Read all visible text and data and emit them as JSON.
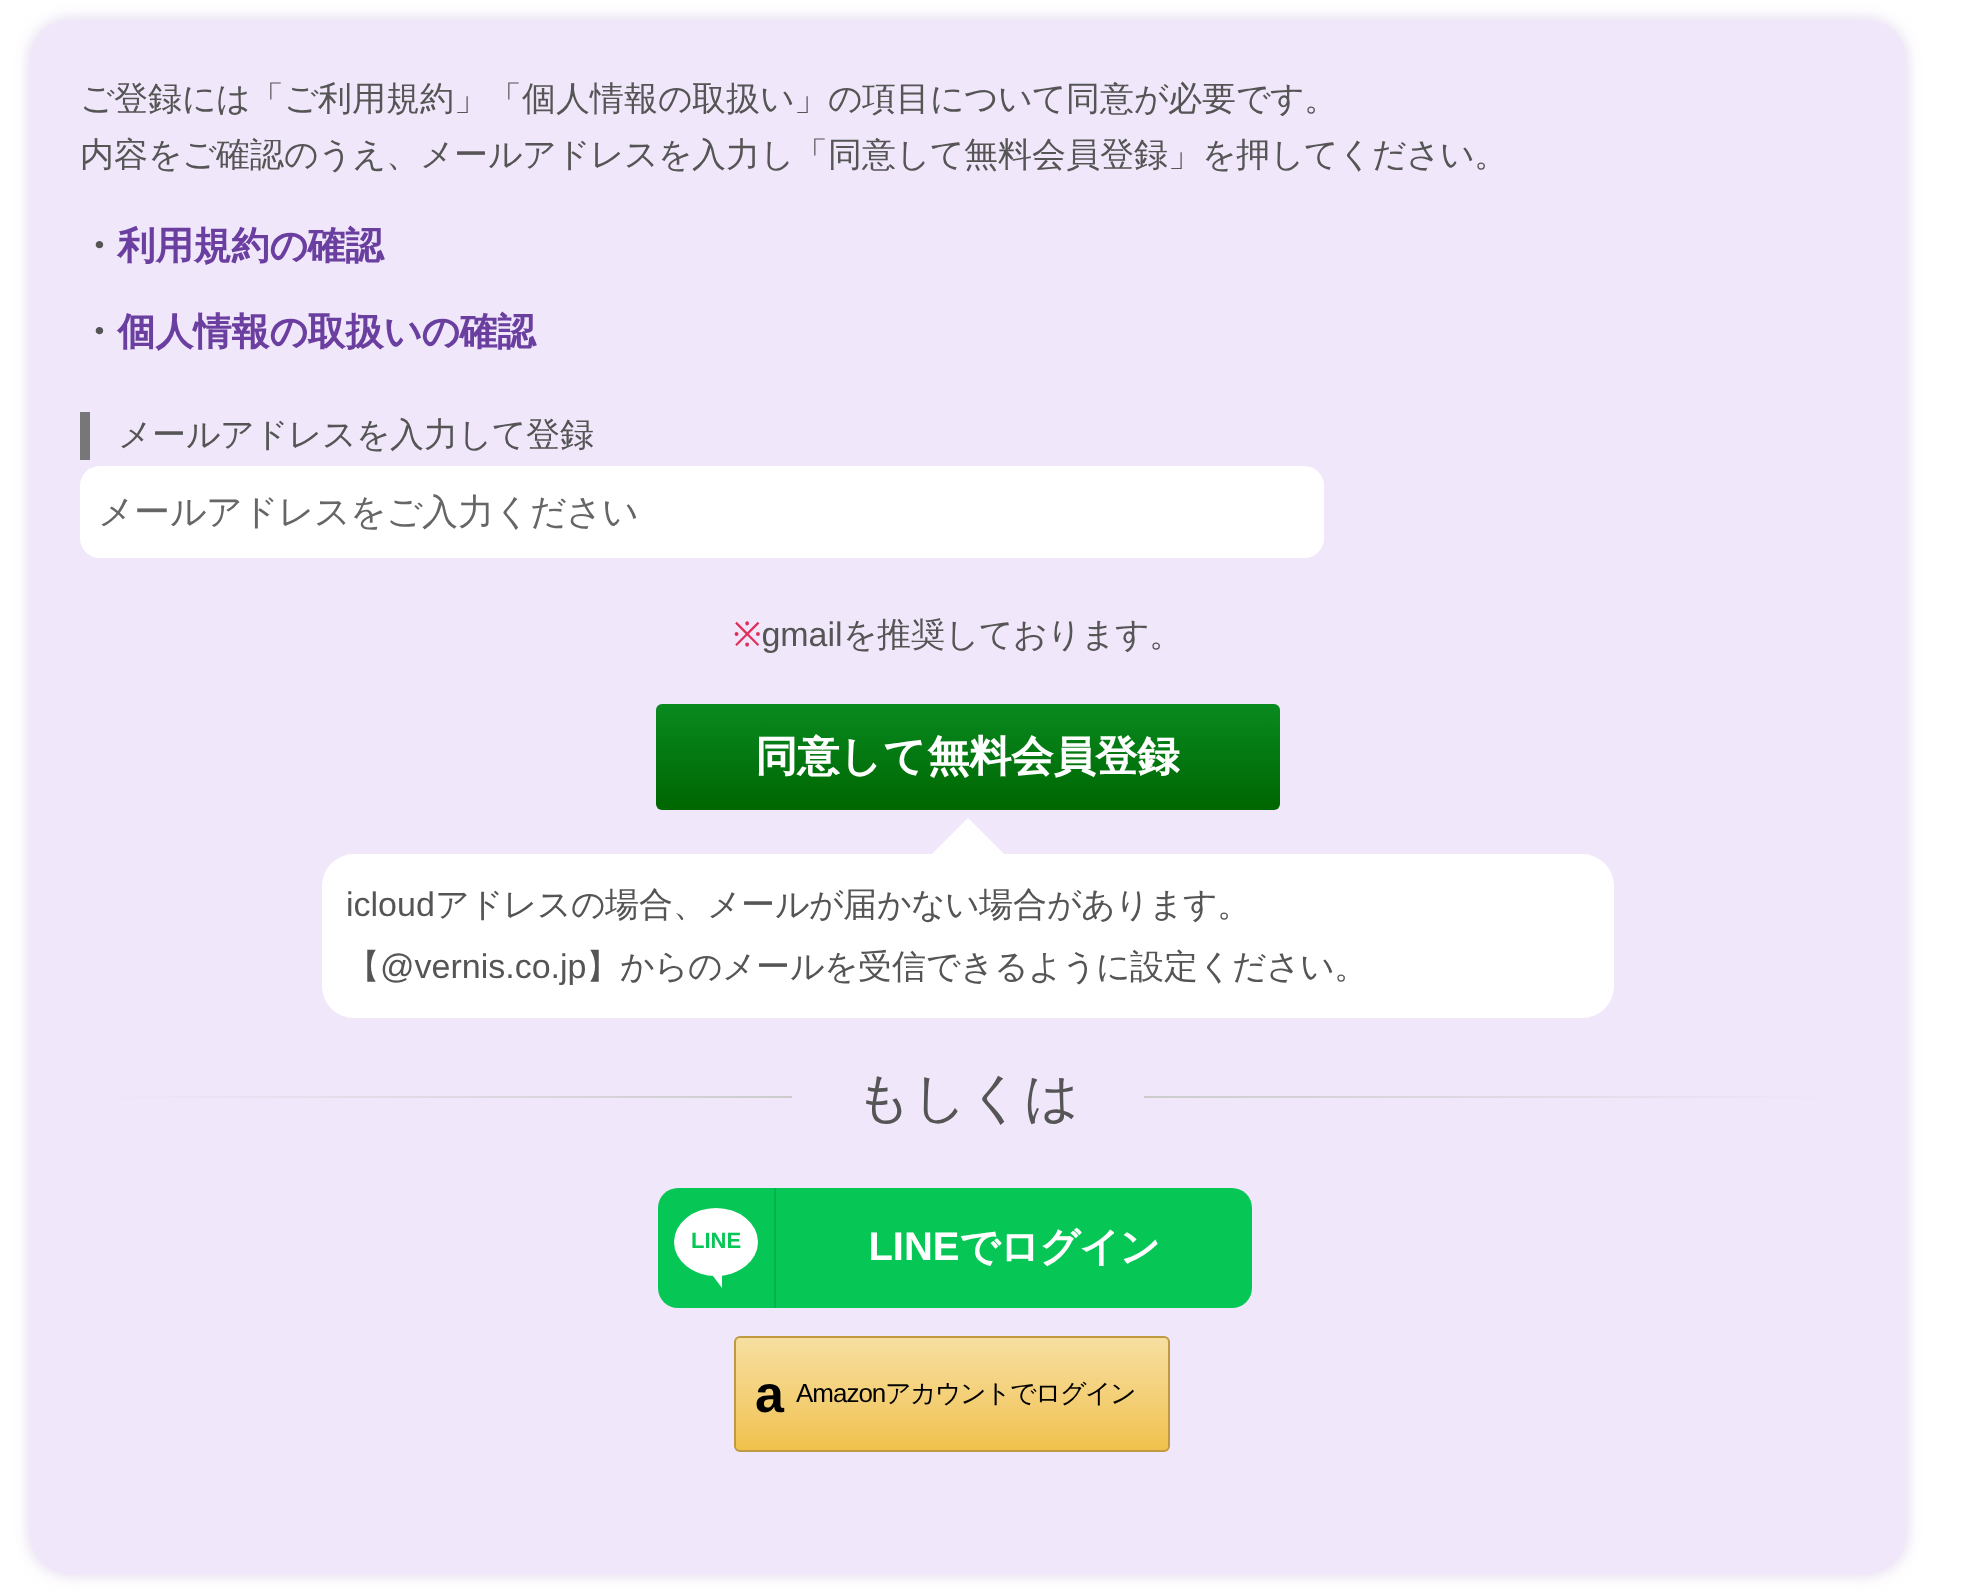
{
  "intro": [
    "ご登録には「ご利用規約」「個人情報の取扱い」の項目について同意が必要です。",
    "内容をご確認のうえ、メールアドレスを入力し「同意して無料会員登録」を押してください。"
  ],
  "links": [
    {
      "bullet": "・",
      "label": "利用規約の確認"
    },
    {
      "bullet": "・",
      "label": "個人情報の取扱いの確認"
    }
  ],
  "email_section": {
    "heading": "メールアドレスを入力して登録",
    "placeholder": "メールアドレスをご入力ください"
  },
  "note": {
    "mark": "※",
    "text": "gmailを推奨しております。"
  },
  "submit_button": "同意して無料会員登録",
  "tip": [
    "icloudアドレスの場合、メールが届かない場合があります。",
    "【@vernis.co.jp】からのメールを受信できるように設定ください。"
  ],
  "divider_label": "もしくは",
  "line_button": {
    "logo": "LINE",
    "label": "LINEでログイン"
  },
  "amazon_button": {
    "logo": "a",
    "label": "Amazonアカウントでログイン"
  }
}
